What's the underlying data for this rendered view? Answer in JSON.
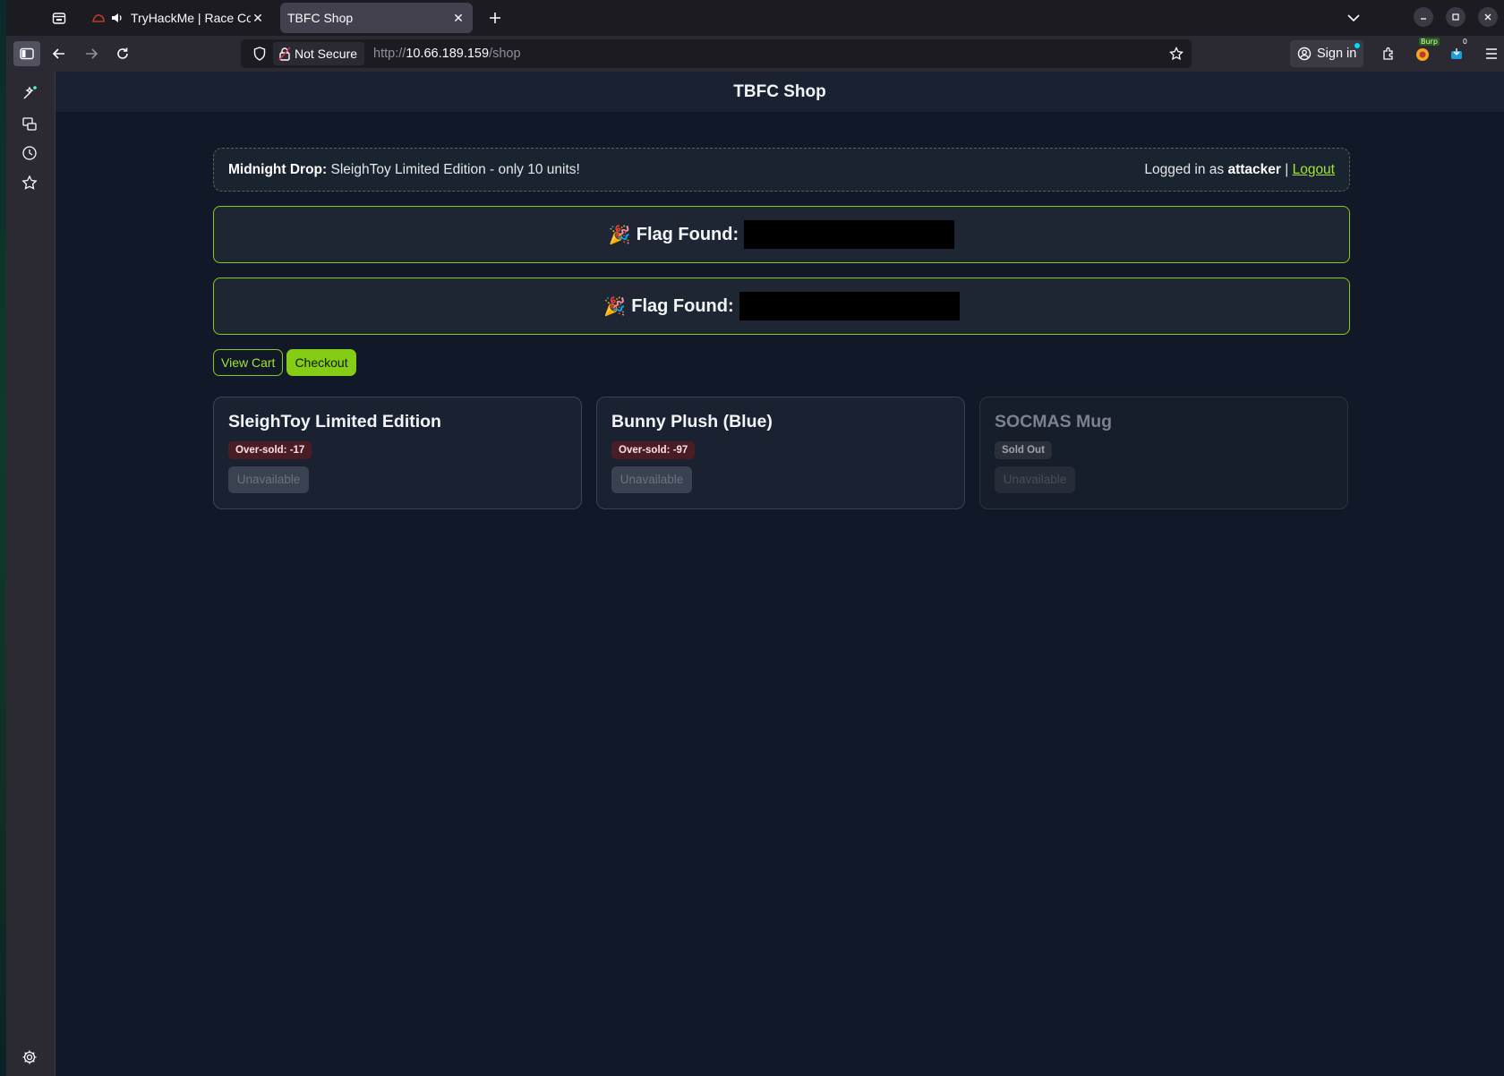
{
  "browser": {
    "tabs": [
      {
        "title": "TryHackMe | Race Cor",
        "audio": true,
        "active": false
      },
      {
        "title": "TBFC Shop",
        "active": true
      }
    ],
    "url": {
      "security_label": "Not Secure",
      "scheme": "http://",
      "host": "10.66.189.159",
      "path": "/shop"
    },
    "sign_in_label": "Sign in",
    "burp_badge": "Burp",
    "counter_badge": "0"
  },
  "header": {
    "title": "TBFC Shop"
  },
  "banner": {
    "drop_label": "Midnight Drop:",
    "drop_text": "SleighToy Limited Edition - only 10 units!",
    "logged_in_prefix": "Logged in as",
    "username": "attacker",
    "separator": "|",
    "logout_label": "Logout"
  },
  "flags": [
    {
      "emoji": "🎉",
      "label": "Flag Found:"
    },
    {
      "emoji": "🎉",
      "label": "Flag Found:"
    }
  ],
  "actions": {
    "view_cart": "View Cart",
    "checkout": "Checkout"
  },
  "products": [
    {
      "name": "SleighToy Limited Edition",
      "badge": "Over-sold: -17",
      "status": "oversold",
      "button": "Unavailable"
    },
    {
      "name": "Bunny Plush (Blue)",
      "badge": "Over-sold: -97",
      "status": "oversold",
      "button": "Unavailable"
    },
    {
      "name": "SOCMAS Mug",
      "badge": "Sold Out",
      "status": "soldout",
      "button": "Unavailable"
    }
  ],
  "colors": {
    "accent": "#84cc16",
    "page_bg": "#111827",
    "oversold_badge": "#4a1d24"
  }
}
